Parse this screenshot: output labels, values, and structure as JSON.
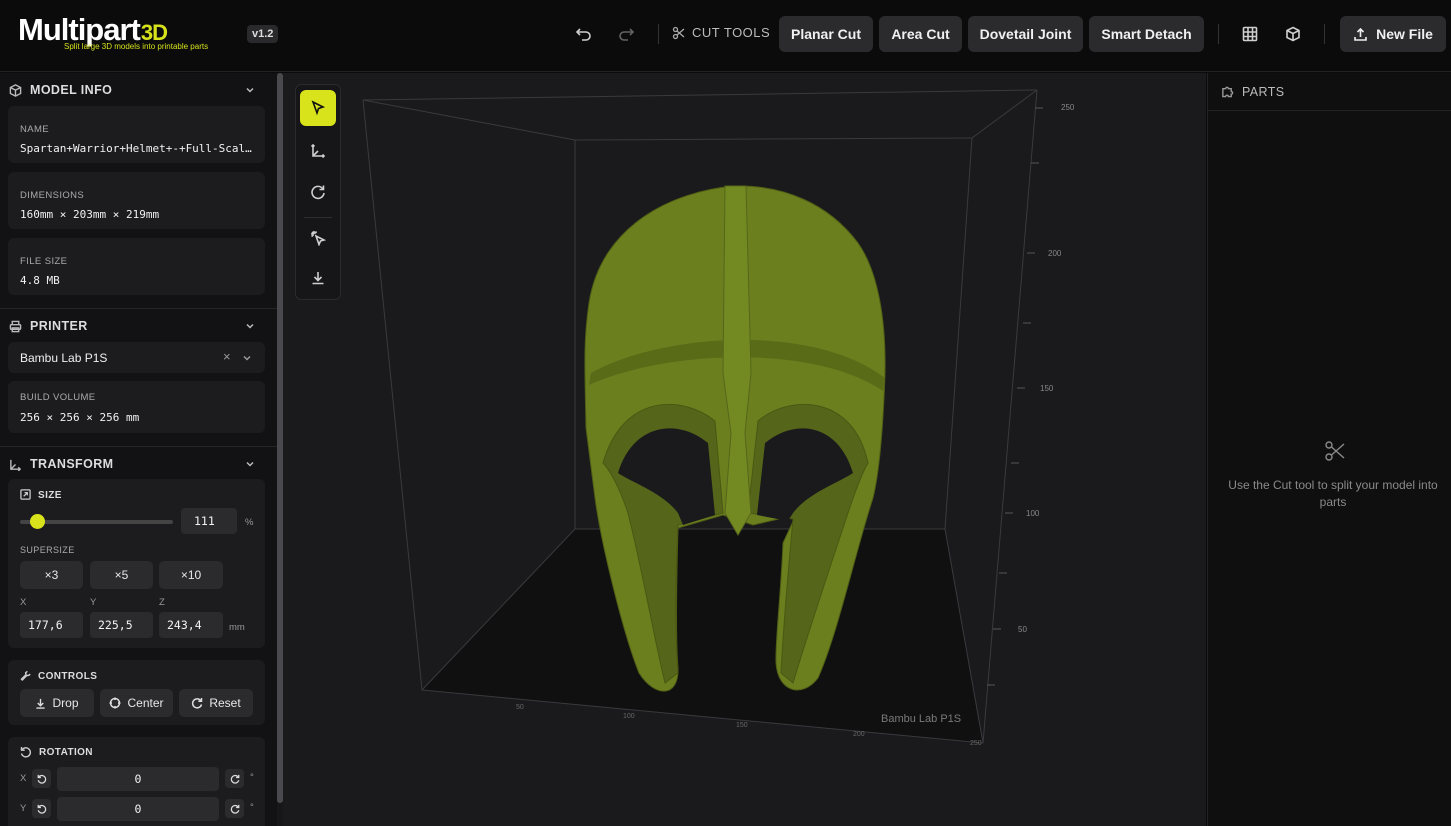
{
  "app": {
    "logo_main": "Multipart",
    "logo_suffix": "3D",
    "tagline": "Split large 3D models into printable parts",
    "version": "v1.2"
  },
  "toolbar": {
    "cut_tools_label": "CUT TOOLS",
    "planar_cut": "Planar Cut",
    "area_cut": "Area Cut",
    "dovetail_joint": "Dovetail Joint",
    "smart_detach": "Smart Detach",
    "new_file": "New File"
  },
  "model_info": {
    "title": "MODEL INFO",
    "name_label": "NAME",
    "name_value": "Spartan+Warrior+Helmet+-+Full-Scal…",
    "dimensions_label": "DIMENSIONS",
    "dimensions_value": "160mm × 203mm × 219mm",
    "file_size_label": "FILE SIZE",
    "file_size_value": "4.8 MB"
  },
  "printer": {
    "title": "PRINTER",
    "selected": "Bambu Lab P1S",
    "build_volume_label": "BUILD VOLUME",
    "build_volume_value": "256 × 256 × 256 mm"
  },
  "transform": {
    "title": "TRANSFORM",
    "size_label": "SIZE",
    "size_value": "111",
    "size_percent": 111,
    "size_unit": "%",
    "supersize_label": "SUPERSIZE",
    "supersize_options": [
      "×3",
      "×5",
      "×10"
    ],
    "x_label": "X",
    "y_label": "Y",
    "z_label": "Z",
    "x_value": "177,6",
    "y_value": "225,5",
    "z_value": "243,4",
    "dim_unit": "mm"
  },
  "controls": {
    "title": "CONTROLS",
    "drop": "Drop",
    "center": "Center",
    "reset": "Reset"
  },
  "rotation": {
    "title": "ROTATION",
    "x_label": "X",
    "y_label": "Y",
    "x_value": "0",
    "y_value": "0",
    "unit": "°"
  },
  "viewport": {
    "printer_label": "Bambu Lab P1S",
    "z_ticks": [
      "250",
      "200",
      "150",
      "100",
      "50"
    ],
    "floor_ticks": [
      "50",
      "100",
      "150",
      "200",
      "250"
    ],
    "model_color": "#6b7f1f",
    "accent": "#d8e31c"
  },
  "parts": {
    "title": "PARTS",
    "empty_message": "Use the Cut tool to split your model into parts"
  }
}
